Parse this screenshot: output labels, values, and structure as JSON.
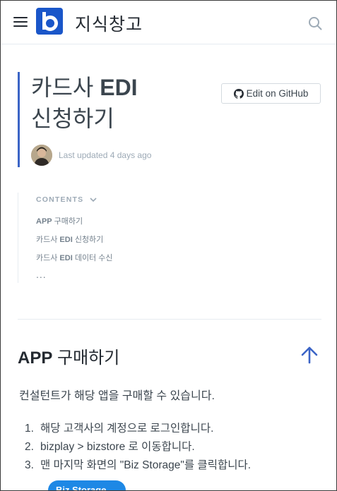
{
  "header": {
    "site_title": "지식창고",
    "logo_letter": "b",
    "brand_color": "#1a56c9"
  },
  "page": {
    "title_prefix": "카드사 ",
    "title_bold": "EDI",
    "title_suffix": " 신청하기",
    "updated": "Last updated 4 days ago",
    "github_button": "Edit on GitHub"
  },
  "contents": {
    "heading": "CONTENTS",
    "items": [
      {
        "bold": "APP",
        "text": " 구매하기"
      },
      {
        "pre": "카드사 ",
        "bold": "EDI",
        "text": " 신청하기"
      },
      {
        "pre": "카드사 ",
        "bold": "EDI",
        "text": " 데이터 수신"
      }
    ],
    "more": "..."
  },
  "section": {
    "title_en": "APP",
    "title_ko": " 구매하기",
    "paragraph": "컨설턴트가 해당 앱을 구매할 수 있습니다.",
    "steps": [
      {
        "num": "1.",
        "text": "해당 고객사의 계정으로 로그인합니다."
      },
      {
        "num": "2.",
        "text": "bizplay > bizstore 로 이동합니다."
      },
      {
        "num": "3.",
        "text": "맨 마지막 화면의 \"Biz Storage\"를 클릭합니다."
      }
    ],
    "store_button": "Biz Storage →"
  },
  "icons": {
    "menu": "hamburger-menu-icon",
    "search": "search-icon",
    "github": "github-icon",
    "chevron": "chevron-down-icon",
    "up": "arrow-up-icon"
  }
}
